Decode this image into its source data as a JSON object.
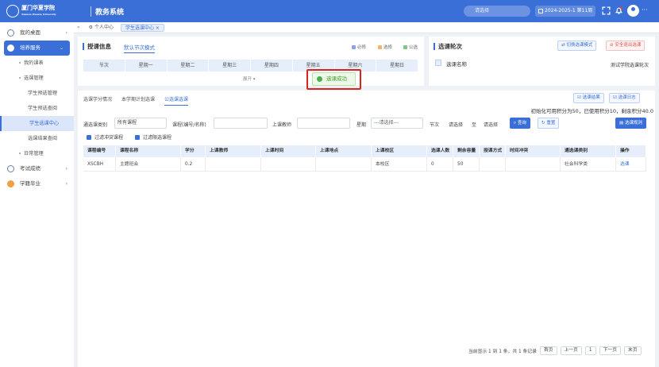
{
  "header": {
    "logo_text": "厦门华夏学院",
    "logo_sub": "Xiamen Huaxia University",
    "system_name": "教务系统",
    "search_placeholder": "请选择",
    "term": "2024-2025-1 第11周",
    "more": "···"
  },
  "sidebar": {
    "items": [
      {
        "label": "我的桌面"
      },
      {
        "label": "培养服务"
      },
      {
        "label": "我的课表"
      },
      {
        "label": "选课管理"
      },
      {
        "label": "学生预选管理"
      },
      {
        "label": "学生预选查阅"
      },
      {
        "label": "学生选课中心"
      },
      {
        "label": "选课结果查阅"
      },
      {
        "label": "日常管理"
      },
      {
        "label": "考试成绩"
      },
      {
        "label": "学籍毕业"
      }
    ]
  },
  "tabs": {
    "home": "个人中心",
    "current": "学生选课中心"
  },
  "schedule": {
    "title": "授课信息",
    "mode": "默认节次模式",
    "legend": [
      "必修",
      "选修",
      "公选"
    ],
    "legend_colors": [
      "#8aa4e6",
      "#f5b37a",
      "#7fc97f"
    ],
    "days": [
      "节次",
      "星期一",
      "星期二",
      "星期三",
      "星期四",
      "星期五",
      "星期六",
      "星期日"
    ],
    "expand": "展开"
  },
  "round": {
    "title": "选课轮次",
    "switch_btn": "切换选课模式",
    "exit_btn": "安全退出选课",
    "name_label": "选课名称",
    "name_value": "测试学院选课轮次"
  },
  "toast": {
    "text": "选课成功"
  },
  "main": {
    "tabs": [
      "选课学分情况",
      "本学期计划选课",
      "公选课选课"
    ],
    "result_btn": "选课结果",
    "log_btn": "选课日志",
    "credit_info": "初始化可用积分为50，已使用积分10，剩余积分40.0",
    "filters": {
      "category_label": "通选课类别",
      "category_value": "所有课程",
      "course_label": "课程(编号/名称)",
      "teacher_label": "上课教师",
      "week_label": "星期",
      "week_value": "---请选择---",
      "section_label": "节次",
      "section_from": "请选择",
      "to": "至",
      "section_to": "请选择",
      "query_btn": "查询",
      "reset_btn": "重置",
      "rules_btn": "选课规则"
    },
    "checks": [
      "过滤冲突课程",
      "过滤限选课程"
    ],
    "table": {
      "headers": [
        "课程编号",
        "课程名称",
        "学分",
        "上课教师",
        "上课时间",
        "上课地点",
        "上课校区",
        "选课人数",
        "剩余容量",
        "授课方式",
        "时间冲突",
        "通选课类别",
        "操作"
      ],
      "rows": [
        [
          "XSCBH",
          "主题班会",
          "0.2",
          "",
          "",
          "",
          "本校区",
          "0",
          "50",
          "",
          "",
          "社会科学类",
          "选课"
        ]
      ]
    },
    "pager": {
      "summary": "当前显示 1 到 1 条，共 1 条记录",
      "first": "首页",
      "prev": "上一页",
      "page": "1",
      "next": "下一页",
      "last": "末页"
    }
  }
}
